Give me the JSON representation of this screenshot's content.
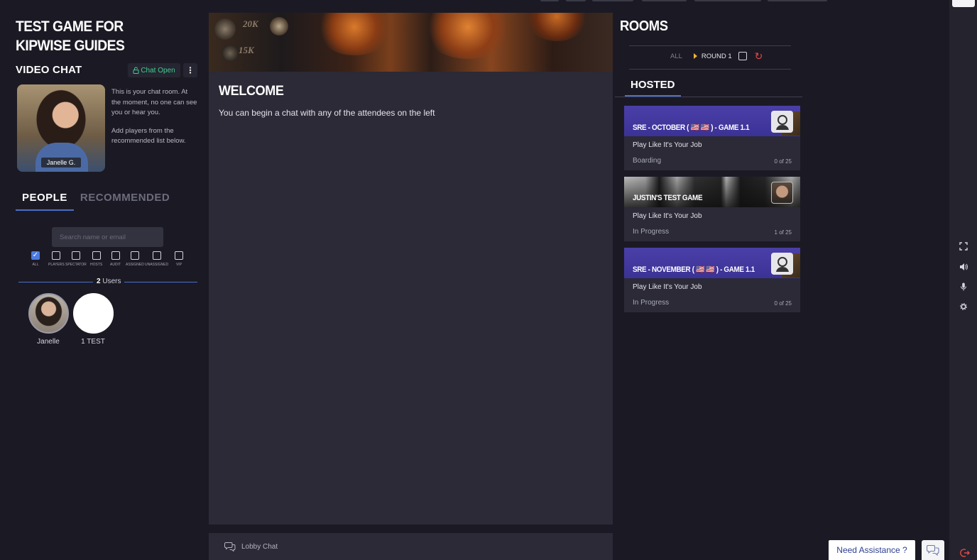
{
  "game": {
    "title": "TEST GAME FOR KIPWISE GUIDES"
  },
  "video_chat": {
    "title": "VIDEO CHAT",
    "chat_open_label": "Chat Open",
    "tile_name": "Janelle G.",
    "info_line1": "This is your chat room. At the moment, no one can see you or hear you.",
    "info_line2": "Add players from the recommended list below."
  },
  "people": {
    "tabs": [
      {
        "label": "PEOPLE"
      },
      {
        "label": "RECOMMENDED"
      }
    ],
    "search_placeholder": "Search name or email",
    "filters": [
      {
        "label": "ALL",
        "checked": true
      },
      {
        "label": "PLAYERS",
        "checked": false
      },
      {
        "label": "SPECTATOR",
        "checked": false
      },
      {
        "label": "HOSTS",
        "checked": false
      },
      {
        "label": "AUDIT",
        "checked": false
      },
      {
        "label": "ASSIGNED",
        "checked": false
      },
      {
        "label": "UNASSIGNED",
        "checked": false
      },
      {
        "label": "VIP",
        "checked": false
      }
    ],
    "users_count": "2",
    "users_label": "Users",
    "users": [
      {
        "name": "Janelle"
      },
      {
        "name": "1 TEST"
      }
    ]
  },
  "banner": {
    "text1": "20K",
    "text2": "15K"
  },
  "welcome": {
    "title": "WELCOME",
    "text": "You can begin a chat with any of the attendees on the left"
  },
  "lobby_chat": {
    "label": "Lobby Chat"
  },
  "rooms": {
    "title": "ROOMS",
    "filter_all": "ALL",
    "round_label": "ROUND 1",
    "hosted_tab": "HOSTED",
    "items": [
      {
        "name": "SRE - OCTOBER ( 🇺🇸 🇺🇸 ) - GAME 1.1",
        "subtitle": "Play Like It's Your Job",
        "status": "Boarding",
        "count": "0 of 25"
      },
      {
        "name": "JUSTIN'S TEST GAME",
        "subtitle": "Play Like It's Your Job",
        "status": "In Progress",
        "count": "1 of 25"
      },
      {
        "name": "SRE - NOVEMBER ( 🇺🇸 🇺🇸 ) - GAME 1.1",
        "subtitle": "Play Like It's Your Job",
        "status": "In Progress",
        "count": "0 of 25"
      }
    ]
  },
  "rail": {
    "icons": [
      "fullscreen-icon",
      "speaker-icon",
      "microphone-icon",
      "settings-icon",
      "exit-icon"
    ]
  },
  "help": {
    "need_assistance": "Need Assistance ?"
  },
  "colors": {
    "background": "#1b1a24",
    "panel": "#2b2a36",
    "accent": "#4c6fc7",
    "chat_open": "#3fcf8e",
    "room_header": "#4a3fa8",
    "refresh": "#e34848"
  }
}
